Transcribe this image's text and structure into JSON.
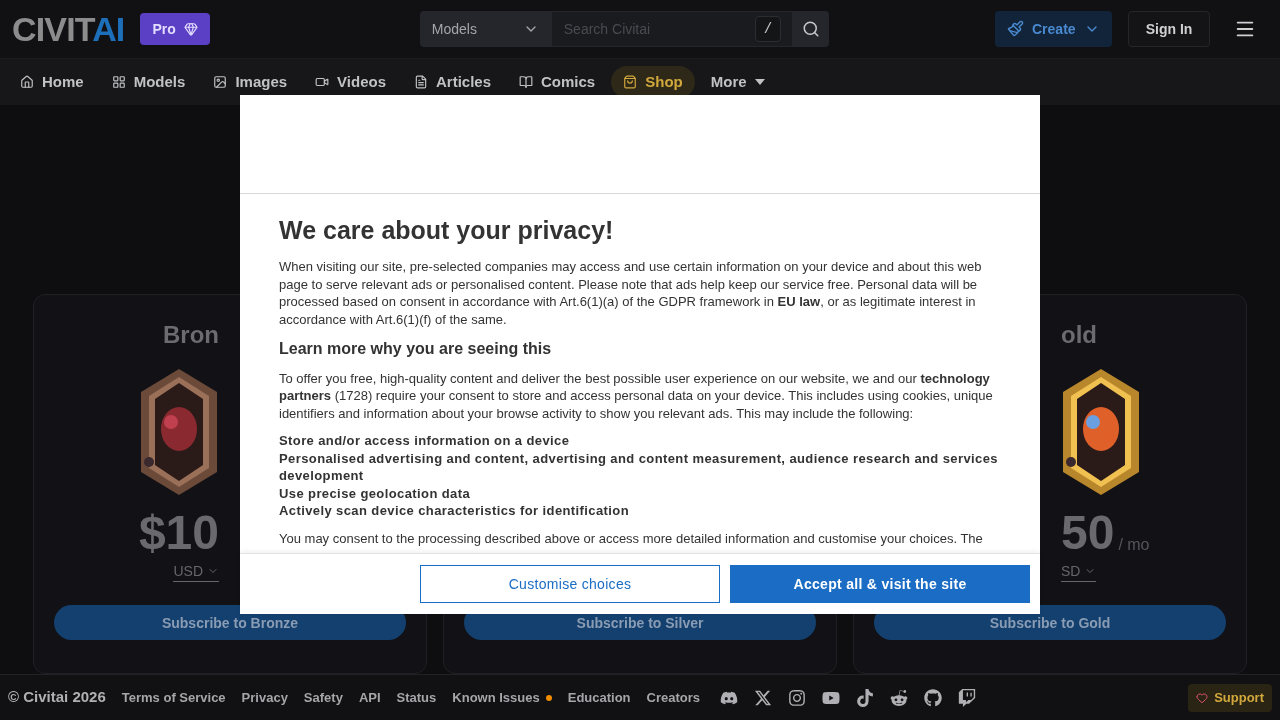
{
  "header": {
    "logo": {
      "part_1": "CIVIT",
      "part_2": "AI"
    },
    "pro_badge": "Pro",
    "search": {
      "scope": "Models",
      "placeholder": "Search Civitai",
      "shortcut": "/"
    },
    "create_button": "Create",
    "sign_in_button": "Sign In"
  },
  "nav": [
    {
      "label": "Home",
      "selected": false
    },
    {
      "label": "Models",
      "selected": false
    },
    {
      "label": "Images",
      "selected": false
    },
    {
      "label": "Videos",
      "selected": false
    },
    {
      "label": "Articles",
      "selected": false
    },
    {
      "label": "Comics",
      "selected": false
    },
    {
      "label": "Shop",
      "selected": true
    },
    {
      "label": "More",
      "selected": false
    }
  ],
  "plans": [
    {
      "title": "Bron",
      "price": "$10",
      "currency": "USD",
      "button": "Subscribe to Bronze"
    },
    {
      "button": "Subscribe to Silver"
    },
    {
      "title": "old",
      "price": "50",
      "period": "/ mo",
      "currency": "SD",
      "button": "Subscribe to Gold"
    }
  ],
  "consent_dialog": {
    "title": "We care about your privacy!",
    "intro": "When visiting our site, pre-selected companies may access and use certain information on your device and about this web page to serve relevant ads or personalised content. Please note that ads help keep our service free. Personal data will be processed based on consent in accordance with Art.6(1)(a) of the GDPR framework in **EU law**, or as legitimate interest in accordance with Art.6(1)(f) of the same.",
    "subtitle": "Learn more why you are seeing this",
    "details": "To offer you free, high-quality content and deliver the best possible user experience on our website, we and our **technology partners** (1728) require your consent to store and access personal data on your device. This includes using cookies, unique identifiers and information about your browse activity to show you relevant ads. This may include the following:",
    "purposes": [
      "Store and/or access information on a device",
      "Personalised advertising and content, advertising and content measurement, audience research and services development",
      "Use precise geolocation data",
      "Actively scan device characteristics for identification"
    ],
    "outro": "You may consent to the processing described above or access more detailed information and customise your choices. The",
    "buttons": [
      {
        "label": "Customise choices",
        "kind": "outline"
      },
      {
        "label": "Accept all & visit the site",
        "kind": "primary"
      }
    ]
  },
  "footer": {
    "copyright": "© Civitai 2026",
    "links": [
      {
        "label": "Terms of Service"
      },
      {
        "label": "Privacy"
      },
      {
        "label": "Safety"
      },
      {
        "label": "API"
      },
      {
        "label": "Status"
      },
      {
        "label": "Known Issues",
        "color": "#f08c00"
      },
      {
        "label": "Education"
      },
      {
        "label": "Creators"
      }
    ],
    "support_button": "Support"
  }
}
